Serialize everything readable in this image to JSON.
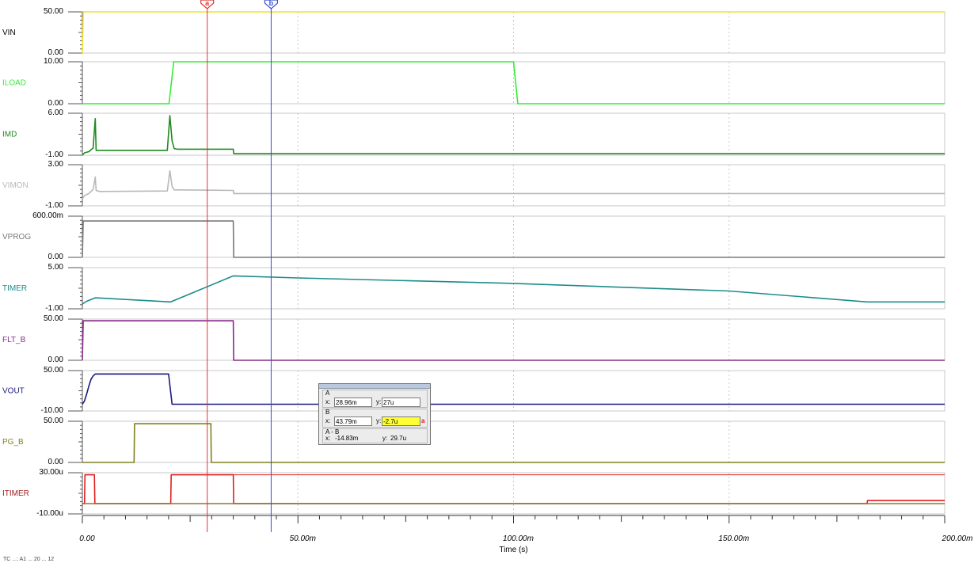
{
  "chart_data": {
    "type": "line",
    "xlabel": "Time (s)",
    "xlim": [
      0,
      0.2
    ],
    "x_tick_labels": [
      "0.00",
      "50.00m",
      "100.00m",
      "150.00m",
      "200.00m"
    ],
    "x_ticks": [
      0,
      0.05,
      0.1,
      0.15,
      0.2
    ],
    "grid": true,
    "cursors": [
      {
        "name": "a",
        "x": 0.02896,
        "color": "#e0332e"
      },
      {
        "name": "b",
        "x": 0.04379,
        "color": "#3b4dd6"
      }
    ],
    "traces": [
      {
        "name": "VIN",
        "color": "#f0e030",
        "label_color": "#000000",
        "ylim": [
          0,
          50
        ],
        "tick_labels": [
          "50.00",
          "0.00"
        ],
        "x": [
          0,
          0.0002,
          0.2
        ],
        "y": [
          0,
          50,
          50
        ]
      },
      {
        "name": "ILOAD",
        "color": "#33ee33",
        "label_color": "#33ee33",
        "ylim": [
          0,
          10
        ],
        "tick_labels": [
          "10.00",
          "0.00"
        ],
        "x": [
          0,
          0.0201,
          0.0212,
          0.1,
          0.101,
          0.2
        ],
        "y": [
          0,
          0,
          10,
          10,
          0,
          0
        ]
      },
      {
        "name": "IMD",
        "color": "#1f8a1f",
        "label_color": "#1f8a1f",
        "ylim": [
          -1,
          6
        ],
        "tick_labels": [
          "6.00",
          "-1.00"
        ],
        "x": [
          0,
          0.0005,
          0.0015,
          0.0025,
          0.003,
          0.0032,
          0.004,
          0.0197,
          0.0203,
          0.0208,
          0.0213,
          0.022,
          0.035,
          0.0351,
          0.2
        ],
        "y": [
          -1,
          -0.6,
          -0.4,
          0.2,
          5.1,
          -0.2,
          -0.2,
          -0.2,
          5.6,
          1.4,
          0.1,
          0.0,
          0.0,
          -0.75,
          -0.75
        ]
      },
      {
        "name": "VIMON",
        "color": "#b8b8b8",
        "label_color": "#b8b8b8",
        "ylim": [
          -1,
          3
        ],
        "tick_labels": [
          "3.00",
          "-1.00"
        ],
        "x": [
          0,
          0.0005,
          0.0015,
          0.0025,
          0.003,
          0.0032,
          0.004,
          0.0197,
          0.0203,
          0.0208,
          0.0213,
          0.022,
          0.035,
          0.0351,
          0.2
        ],
        "y": [
          -0.3,
          0.0,
          0.2,
          0.6,
          1.8,
          0.5,
          0.4,
          0.45,
          2.4,
          0.9,
          0.55,
          0.55,
          0.5,
          0.2,
          0.2
        ]
      },
      {
        "name": "VPROG",
        "color": "#7a7a7a",
        "label_color": "#7a7a7a",
        "ylim": [
          0,
          0.6
        ],
        "tick_labels": [
          "600.00m",
          "0.00"
        ],
        "x": [
          0,
          0.0002,
          0.035,
          0.0351,
          0.2
        ],
        "y": [
          0,
          0.53,
          0.53,
          0,
          0
        ]
      },
      {
        "name": "TIMER",
        "color": "#1c8c8c",
        "label_color": "#1c8c8c",
        "ylim": [
          -1,
          5
        ],
        "tick_labels": [
          "5.00",
          "-1.00"
        ],
        "x": [
          0,
          0.001,
          0.003,
          0.0205,
          0.035,
          0.05,
          0.1,
          0.15,
          0.182,
          0.2
        ],
        "y": [
          -0.3,
          0.1,
          0.6,
          0.0,
          3.8,
          3.5,
          2.7,
          1.6,
          0.0,
          0.0
        ]
      },
      {
        "name": "FLT_B",
        "color": "#8a2a8a",
        "label_color": "#8a2a8a",
        "ylim": [
          0,
          50
        ],
        "tick_labels": [
          "50.00",
          "0.00"
        ],
        "x": [
          0,
          0.0002,
          0.035,
          0.0351,
          0.2
        ],
        "y": [
          0,
          48,
          48,
          0,
          0
        ]
      },
      {
        "name": "VOUT",
        "color": "#1a1a80",
        "label_color": "#1a1a80",
        "ylim": [
          -10,
          50
        ],
        "tick_labels": [
          "50.00",
          "-10.00"
        ],
        "x": [
          0,
          0.0005,
          0.001,
          0.0015,
          0.002,
          0.0025,
          0.003,
          0.02,
          0.0208,
          0.2
        ],
        "y": [
          0,
          5,
          15,
          27,
          37,
          42,
          45,
          45,
          0,
          0
        ]
      },
      {
        "name": "PG_B",
        "color": "#808020",
        "label_color": "#808020",
        "ylim": [
          0,
          50
        ],
        "tick_labels": [
          "50.00",
          "0.00"
        ],
        "x": [
          0,
          0.012,
          0.0121,
          0.0298,
          0.0299,
          0.2
        ],
        "y": [
          0,
          0,
          47,
          47,
          0,
          0
        ]
      },
      {
        "name": "ITIMER",
        "color": "#e02020",
        "label_color": "#a02020",
        "ylim": [
          -10,
          30
        ],
        "tick_labels": [
          "30.00u",
          "-10.00u"
        ],
        "x": [
          0,
          0.0005,
          0.0006,
          0.0028,
          0.0029,
          0.0205,
          0.0206,
          0.035,
          0.0351,
          0.182,
          0.1821,
          0.2
        ],
        "y": [
          0,
          0,
          28,
          28,
          0,
          0,
          28,
          28,
          0,
          0,
          3,
          3
        ]
      },
      {
        "name": "",
        "color": "#8a7a30",
        "label_color": "#8a7a30",
        "ylim": [
          -10,
          30
        ],
        "tick_labels": [],
        "x": [
          0,
          0.2
        ],
        "y": [
          0,
          0
        ],
        "overlay_on": 9
      },
      {
        "name": "",
        "color": "#e02020",
        "label_color": "#e02020",
        "ylim": [
          -10,
          30
        ],
        "tick_labels": [],
        "x": [
          0.035,
          0.2
        ],
        "y": [
          28,
          28
        ],
        "overlay_on": 9,
        "thin": true
      }
    ]
  },
  "cursor_panel": {
    "a_label": "A",
    "a_x": "28.96m",
    "a_y": "27u",
    "b_label": "B",
    "b_x": "43.79m",
    "b_y": "-2.7u",
    "b_marker": "a",
    "diff_label": "A - B",
    "diff_x": "-14.83m",
    "diff_y": "29.7u",
    "x_prefix": "x:",
    "y_prefix": "y:"
  },
  "status_text": "TC ...: A1 ... 20 ... 12"
}
